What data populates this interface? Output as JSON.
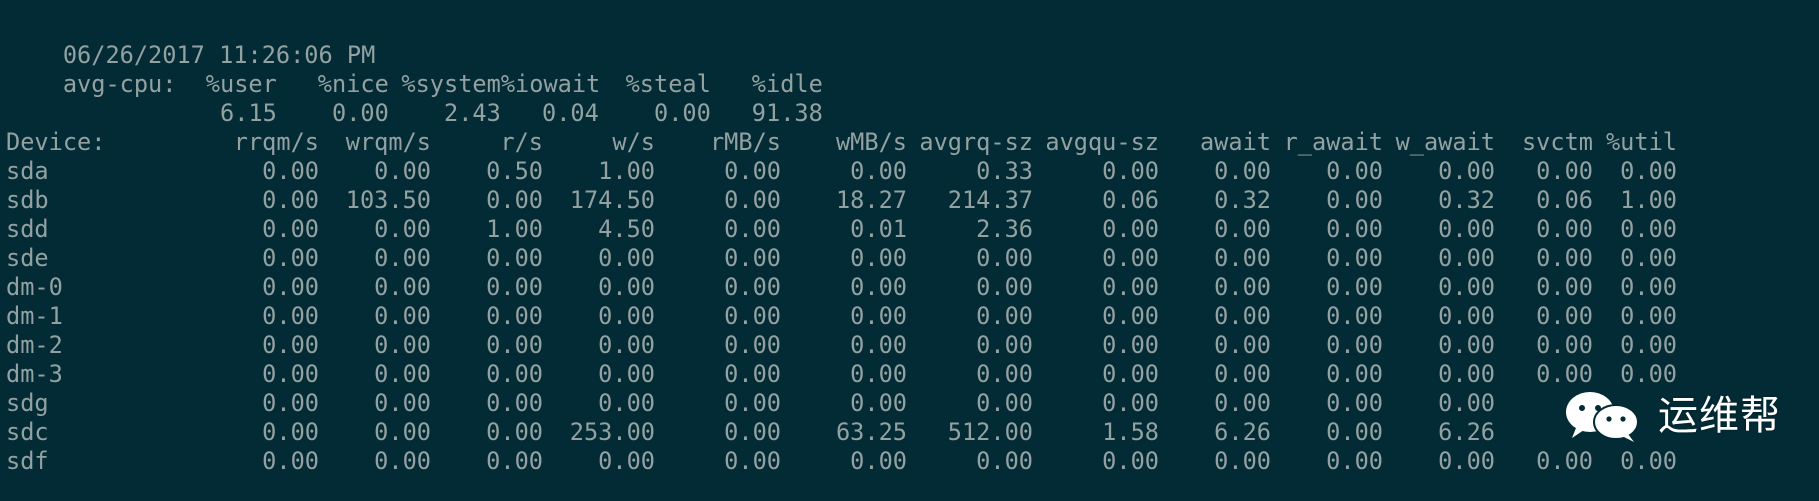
{
  "timestamp": "06/26/2017 11:26:06 PM",
  "cpu": {
    "label": "avg-cpu:",
    "headers": [
      "%user",
      "%nice",
      "%system",
      "%iowait",
      "%steal",
      "%idle"
    ],
    "values": [
      "6.15",
      "0.00",
      "2.43",
      "0.04",
      "0.00",
      "91.38"
    ]
  },
  "devices": {
    "headers": [
      "Device:",
      "rrqm/s",
      "wrqm/s",
      "r/s",
      "w/s",
      "rMB/s",
      "wMB/s",
      "avgrq-sz",
      "avgqu-sz",
      "await",
      "r_await",
      "w_await",
      "svctm",
      "%util"
    ],
    "rows": [
      [
        "sda",
        "0.00",
        "0.00",
        "0.50",
        "1.00",
        "0.00",
        "0.00",
        "0.33",
        "0.00",
        "0.00",
        "0.00",
        "0.00",
        "0.00",
        "0.00"
      ],
      [
        "sdb",
        "0.00",
        "103.50",
        "0.00",
        "174.50",
        "0.00",
        "18.27",
        "214.37",
        "0.06",
        "0.32",
        "0.00",
        "0.32",
        "0.06",
        "1.00"
      ],
      [
        "sdd",
        "0.00",
        "0.00",
        "1.00",
        "4.50",
        "0.00",
        "0.01",
        "2.36",
        "0.00",
        "0.00",
        "0.00",
        "0.00",
        "0.00",
        "0.00"
      ],
      [
        "sde",
        "0.00",
        "0.00",
        "0.00",
        "0.00",
        "0.00",
        "0.00",
        "0.00",
        "0.00",
        "0.00",
        "0.00",
        "0.00",
        "0.00",
        "0.00"
      ],
      [
        "dm-0",
        "0.00",
        "0.00",
        "0.00",
        "0.00",
        "0.00",
        "0.00",
        "0.00",
        "0.00",
        "0.00",
        "0.00",
        "0.00",
        "0.00",
        "0.00"
      ],
      [
        "dm-1",
        "0.00",
        "0.00",
        "0.00",
        "0.00",
        "0.00",
        "0.00",
        "0.00",
        "0.00",
        "0.00",
        "0.00",
        "0.00",
        "0.00",
        "0.00"
      ],
      [
        "dm-2",
        "0.00",
        "0.00",
        "0.00",
        "0.00",
        "0.00",
        "0.00",
        "0.00",
        "0.00",
        "0.00",
        "0.00",
        "0.00",
        "0.00",
        "0.00"
      ],
      [
        "dm-3",
        "0.00",
        "0.00",
        "0.00",
        "0.00",
        "0.00",
        "0.00",
        "0.00",
        "0.00",
        "0.00",
        "0.00",
        "0.00",
        "0.00",
        "0.00"
      ],
      [
        "sdg",
        "0.00",
        "0.00",
        "0.00",
        "0.00",
        "0.00",
        "0.00",
        "0.00",
        "0.00",
        "0.00",
        "0.00",
        "0.00",
        "",
        ""
      ],
      [
        "sdc",
        "0.00",
        "0.00",
        "0.00",
        "253.00",
        "0.00",
        "63.25",
        "512.00",
        "1.58",
        "6.26",
        "0.00",
        "6.26",
        "",
        ""
      ],
      [
        "sdf",
        "0.00",
        "0.00",
        "0.00",
        "0.00",
        "0.00",
        "0.00",
        "0.00",
        "0.00",
        "0.00",
        "0.00",
        "0.00",
        "0.00",
        "0.00"
      ]
    ]
  },
  "watermark": {
    "text": "运维帮",
    "icon": "wechat-icon"
  },
  "colors": {
    "background": "#022b36",
    "text": "#93a1a1",
    "watermark_text": "#ffffff"
  }
}
